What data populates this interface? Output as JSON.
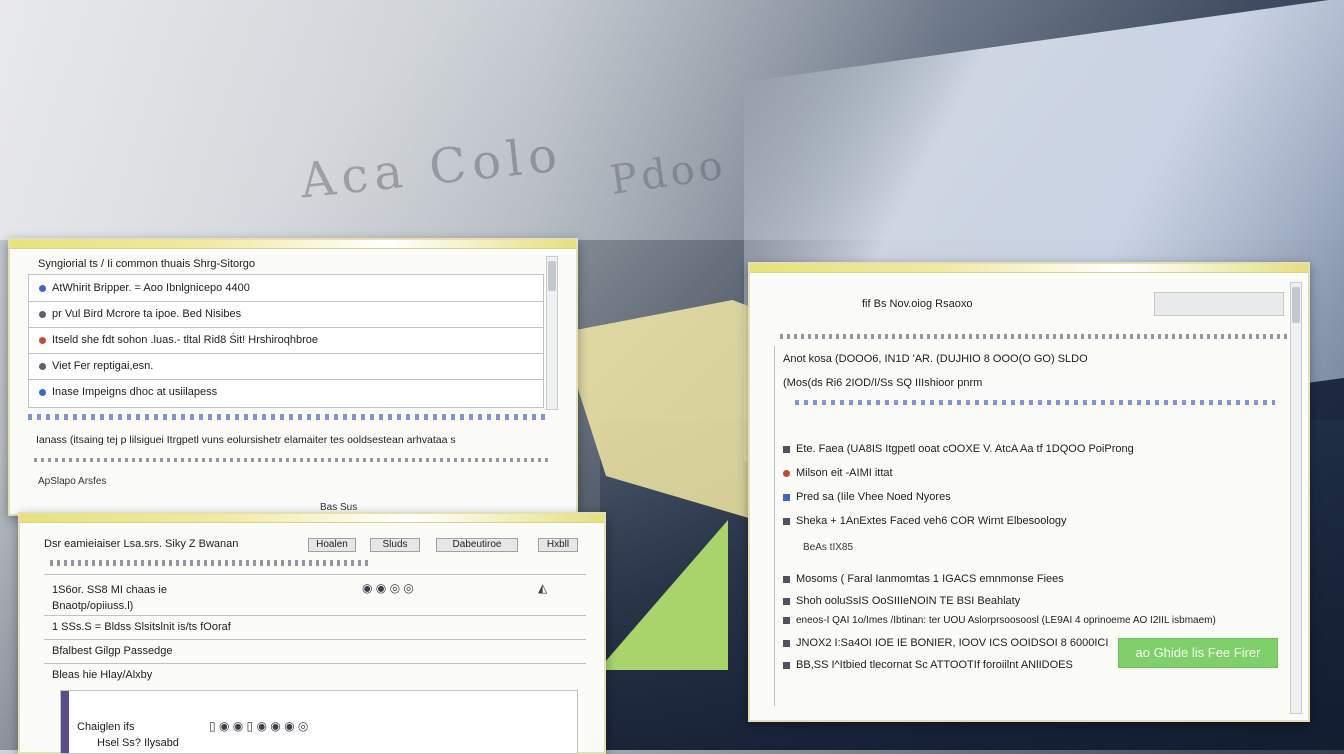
{
  "colors": {
    "accent": "#3f66c5",
    "success": "#7fd06a",
    "window_border": "#e3e0b8"
  },
  "background": {
    "watermark_a": "Aca Colo",
    "watermark_b": "Pdoo"
  },
  "window_left": {
    "header": "Syngiorial ts / Ii common thuais Shrg-Sitorgo",
    "rows": [
      "AtWhirit Bripper. = Aoo Ibnlgnicepo 4400",
      "pr Vul Bird Mcrore ta ipoe. Bed Nisibes",
      "Itseld she fdt sohon .luas.- tltal Rid8 Ṡit! Hrshiroqhbroe",
      "Viet Fer reptigai,esn.",
      "Inase Impeigns dhoc at usiilapess"
    ],
    "footer_line": "Ianass (itsaing tej p lilsiguei Itrgpetl vuns eolursishetr elamaiter tes ooldsestean arhvataa s",
    "status": "ApSlapo Arsfes",
    "label": "Bas Sus"
  },
  "window_lower": {
    "header": "Dsr eamieiaiser Lsa.srs. Siky Z Bwanan",
    "btn_a": "Hoalen",
    "btn_b": "Sluds",
    "btn_c": "Dabeutiroe",
    "btn_d": "Hxbll",
    "rows": [
      "1S6or. SS8 MI chaas ie",
      "Bnaotp/opiiuss.l)",
      "1 SSs.S = Bldss Slsitslnit is/ts fOoraf",
      "Bfalbest Gilgp Passedge",
      "Bleas hie Hlay/Alxby"
    ],
    "sub_header": "Chaiglen ifs",
    "sub_row": "Hsel Ss? Ilysabd"
  },
  "window_right": {
    "header": "fif Bs Nov.oiog Rsaoxo",
    "rows": [
      "Anot kosa (DOOO6, IN1D 'AR. (DUJHIO 8 OOO(O GO) SLDO",
      "(Mos(ds Ri6 2IOD/I/Ss SQ IIIshioor pnrm",
      "Ete. Faea (UA8IS Itgpetl ooat cOOXE V. AtcA Aa tf 1DQOO PoiProng",
      "Milson eit -AIMI ittat",
      "Pred sa (Iile Vhee Noed Nyores",
      "Sheka + 1AnExtes Faced veh6 COR Wirnt Elbesoology",
      "BeAs tIX85",
      "Mosoms ( Faral Ianmomtas 1 IGACS emnmonse Fiees",
      "Shoh ooluSsIS OoSIIIeNOIN TE BSI Beahlaty",
      "eneos-I QAI 1o/Imes /Ibtinan: ter UOU Aslorprsoosoosl (LE9AI 4 oprinoeme AO I2IIL isbmaem)",
      "JNOX2 I:Sa4OI IOE IE BONIER, IOOV ICS OOIDSOI 8 6000ICI",
      "BB,SS I^Itbied tlecornat Sc ATTOOTIf foroiilnt ANlIDOES"
    ],
    "cta": "ao Ghide lis Fee Firer"
  }
}
